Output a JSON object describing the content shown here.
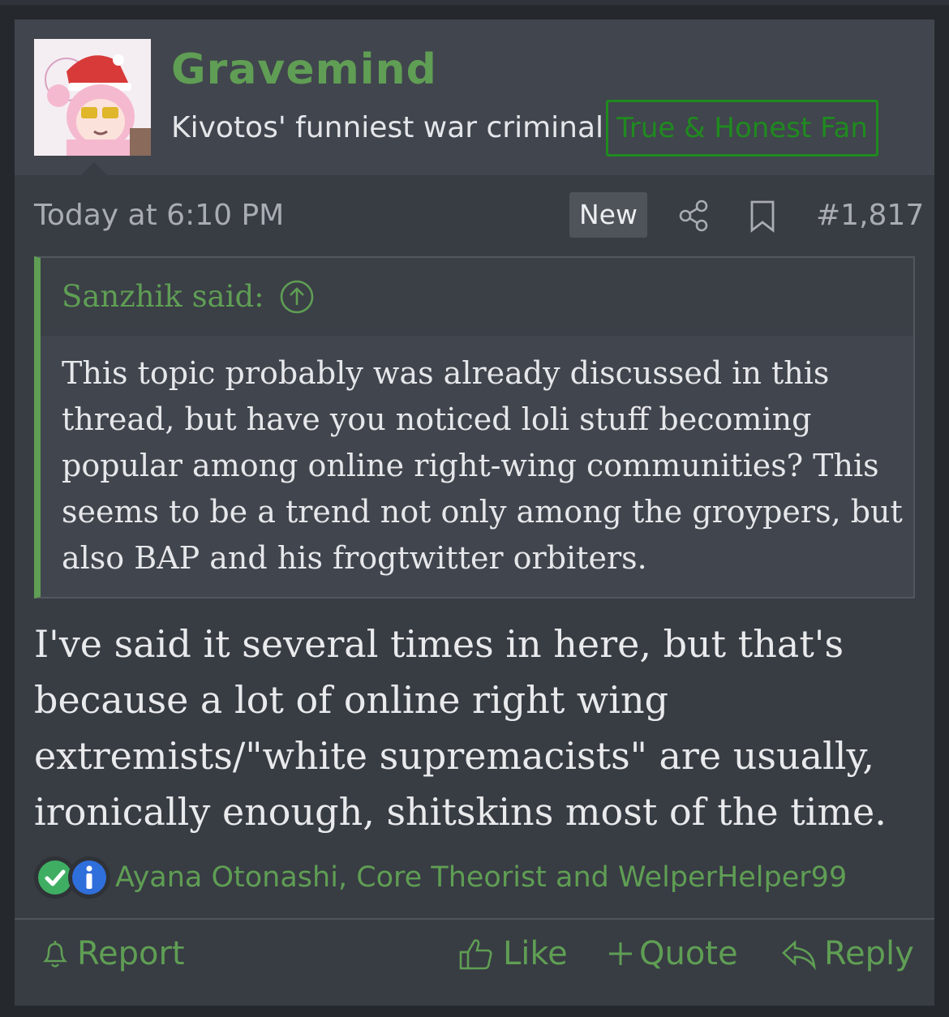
{
  "post": {
    "username": "Gravemind",
    "user_title": "Kivotos' funniest war criminal",
    "user_banner": "True & Honest Fan",
    "timestamp": "Today at 6:10 PM",
    "new_badge": "New",
    "post_number": "#1,817",
    "quote": {
      "author": "Sanzhik said:",
      "text": "This topic probably was already discussed in this thread, but have you noticed loli stuff becoming popular among online right-wing communities? This seems to be a trend not only among the groypers, but also BAP and his frogtwitter orbiters."
    },
    "message": "I've said it several times in here, but that's because a lot of online right wing extremists/\"white supremacists\" are usually, ironically enough, shitskins most of the time.",
    "reactions": {
      "icons": [
        "check-reaction-icon",
        "info-reaction-icon"
      ],
      "names": "Ayana Otonashi, Core Theorist and WelperHelper99"
    },
    "actions": {
      "report": "Report",
      "like": "Like",
      "quote": "Quote",
      "reply": "Reply"
    }
  },
  "colors": {
    "accent": "#5f9e54",
    "banner": "#1f8a1f",
    "background": "#383c43",
    "header": "#41454d"
  }
}
